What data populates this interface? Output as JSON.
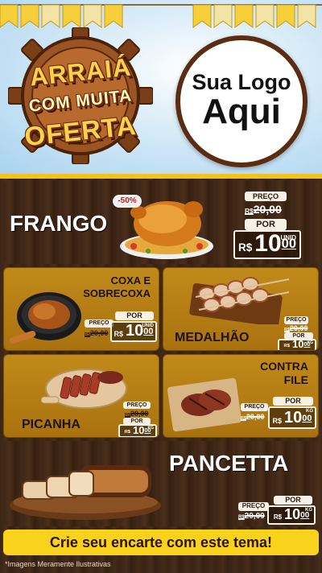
{
  "header": {
    "title_lines": [
      "ARRAIÁ",
      "COM MUITA",
      "OFERTA"
    ],
    "logo_line1": "Sua Logo",
    "logo_line2": "Aqui"
  },
  "colors": {
    "accent_yellow": "#f4c21c",
    "wood_dark": "#3a2516",
    "gold_panel": "#c08a1a",
    "discount_red": "#c0241c"
  },
  "products": {
    "frango": {
      "name": "FRANGO",
      "discount": "-50%",
      "preco_label": "PREÇO",
      "old_rs": "R$",
      "old_price": "20,00",
      "por_label": "POR",
      "rs": "R$",
      "price_int": "10",
      "price_cents": "00",
      "unit": "UNID"
    },
    "coxa": {
      "name_l1": "COXA E",
      "name_l2": "SOBRECOXA",
      "preco_label": "PREÇO",
      "old_rs": "R$",
      "old_price": "20,00",
      "por_label": "POR",
      "rs": "R$",
      "price_int": "10",
      "price_cents": "00",
      "unit": "UNID"
    },
    "medalhao": {
      "name": "MEDALHÃO",
      "preco_label": "PREÇO",
      "old_rs": "R$",
      "old_price": "20,00",
      "por_label": "POR",
      "rs": "R$",
      "price_int": "10",
      "price_cents": "00",
      "unit": "KG"
    },
    "picanha": {
      "name": "PICANHA",
      "preco_label": "PREÇO",
      "old_rs": "R$",
      "old_price": "20,00",
      "por_label": "POR",
      "rs": "R$",
      "price_int": "10",
      "price_cents": "00",
      "unit": "KG"
    },
    "contra": {
      "name_l1": "CONTRA",
      "name_l2": "FILE",
      "preco_label": "PREÇO",
      "old_rs": "R$",
      "old_price": "20,00",
      "por_label": "POR",
      "rs": "R$",
      "price_int": "10",
      "price_cents": "00",
      "unit": "KG"
    },
    "pancetta": {
      "name": "PANCETTA",
      "preco_label": "PREÇO",
      "old_rs": "R$",
      "old_price": "20,00",
      "por_label": "POR",
      "rs": "R$",
      "price_int": "10",
      "price_cents": "00",
      "unit": "KG"
    }
  },
  "cta_text": "Crie seu encarte com este tema!",
  "footnote": "*Imagens Meramente Ilustrativas"
}
